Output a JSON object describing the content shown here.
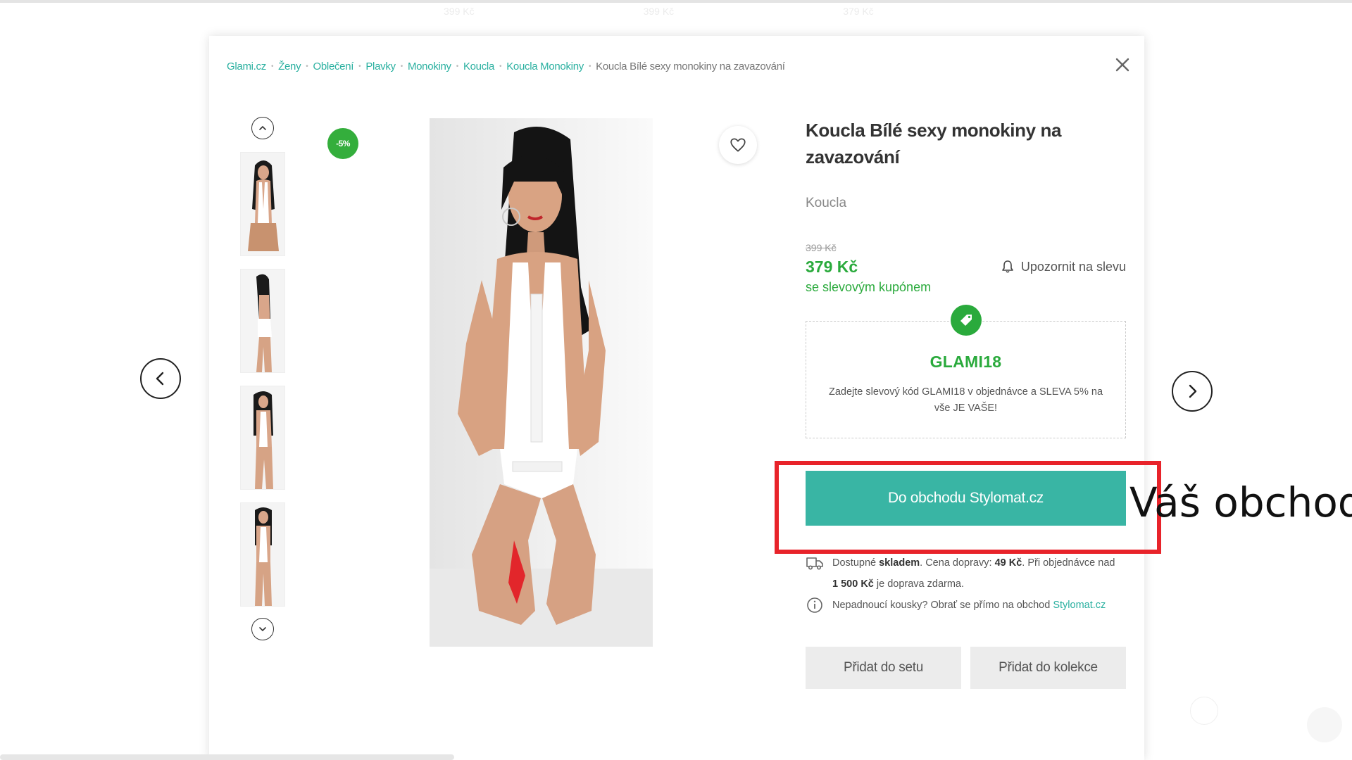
{
  "background_row": [
    "399 Kč",
    "399 Kč",
    "379 Kč"
  ],
  "breadcrumb": [
    "Glami.cz",
    "Ženy",
    "Oblečení",
    "Plavky",
    "Monokiny",
    "Koucla",
    "Koucla Monokiny",
    "Koucla Bílé sexy monokiny na zavazování"
  ],
  "product": {
    "discount_badge": "-5%",
    "title": "Koucla Bílé sexy monokiny na zavazování",
    "brand": "Koucla",
    "old_price": "399 Kč",
    "new_price": "379 Kč",
    "coupon_note": "se slevovým kupónem",
    "notify_label": "Upozornit na slevu"
  },
  "coupon": {
    "code": "GLAMI18",
    "description": "Zadejte slevový kód GLAMI18 v objednávce a SLEVA 5% na vše JE VAŠE!"
  },
  "shop_button": "Do obchodu Stylomat.cz",
  "delivery": {
    "p1": "Dostupné ",
    "stock": "skladem",
    "p2": ". Cena dopravy: ",
    "ship_price": "49 Kč",
    "p3": ". Při objednávce nad ",
    "threshold": "1 500 Kč",
    "p4": " je doprava zdarma."
  },
  "returns": {
    "text": "Nepadnoucí kousky? Obrať se přímo na obchod ",
    "shop": "Stylomat.cz"
  },
  "actions": {
    "add_to_set": "Přidat do setu",
    "add_to_collection": "Přidat do kolekce"
  },
  "annotation": {
    "label": "Váš obchod",
    "color": "#e8232a"
  },
  "colors": {
    "accent": "#39b5a4",
    "price_green": "#2aaa3c",
    "link": "#2ab0a0"
  },
  "icons": [
    "close-icon",
    "chevron-up-icon",
    "chevron-down-icon",
    "heart-icon",
    "bell-icon",
    "tag-icon",
    "truck-icon",
    "info-icon",
    "chevron-left-icon",
    "chevron-right-icon"
  ]
}
